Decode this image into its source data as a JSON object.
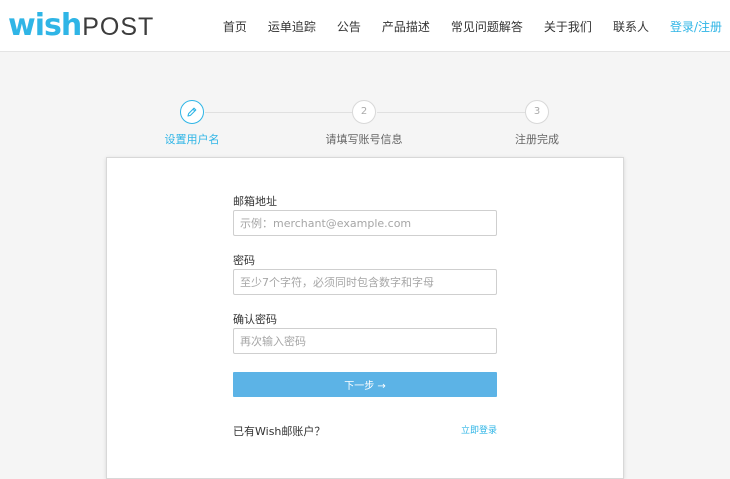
{
  "brand": {
    "logo_wish": "wish",
    "logo_post": "POST",
    "accent": "#2fb5e6"
  },
  "nav": {
    "items": [
      "首页",
      "运单追踪",
      "公告",
      "产品描述",
      "常见问题解答",
      "关于我们",
      "联系人"
    ],
    "login_register": "登录/注册"
  },
  "steps": [
    {
      "number": "",
      "icon": "pencil-icon",
      "label": "设置用户名",
      "active": true
    },
    {
      "number": "2",
      "label": "请填写账号信息",
      "active": false
    },
    {
      "number": "3",
      "label": "注册完成",
      "active": false
    }
  ],
  "form": {
    "email_label": "邮箱地址",
    "email_placeholder": "示例：merchant@example.com",
    "password_label": "密码",
    "password_placeholder": "至少7个字符，必须同时包含数字和字母",
    "confirm_label": "确认密码",
    "confirm_placeholder": "再次输入密码",
    "next_label": "下一步 →",
    "has_account": "已有Wish邮账户？",
    "login_now": "立即登录"
  }
}
